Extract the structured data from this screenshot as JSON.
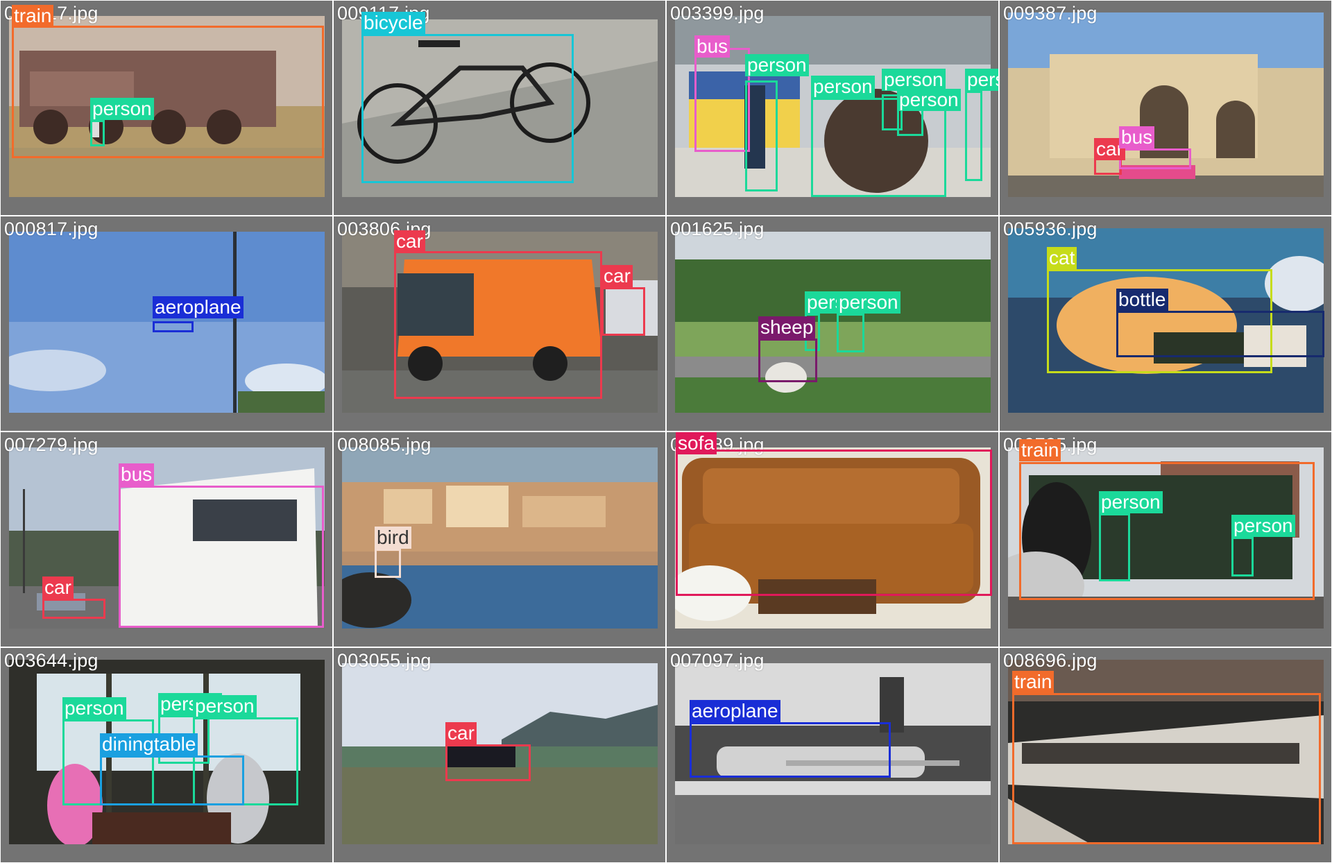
{
  "colors": {
    "train": "#f26b2b",
    "person": "#1bd99a",
    "bicycle": "#17c6d6",
    "bus": "#e85dcb",
    "car": "#ec3a4e",
    "aeroplane": "#1a2ed6",
    "sheep": "#7a1a6b",
    "cat": "#c6dc1a",
    "bottle": "#172a6e",
    "bird": "#f4ddd2",
    "sofa": "#e0195a",
    "diningtable": "#1aa0e0"
  },
  "tiles": [
    {
      "filename": "000017.jpg",
      "scene": "train-rusty",
      "labels": [
        "train",
        "person"
      ]
    },
    {
      "filename": "009117.jpg",
      "scene": "bicycle-street",
      "labels": [
        "bicycle"
      ]
    },
    {
      "filename": "003399.jpg",
      "scene": "bus-station",
      "labels": [
        "bus",
        "person",
        "person",
        "person",
        "person",
        "person"
      ]
    },
    {
      "filename": "009387.jpg",
      "scene": "union-station",
      "labels": [
        "car",
        "bus"
      ]
    },
    {
      "filename": "000817.jpg",
      "scene": "sky-plane",
      "labels": [
        "aeroplane"
      ]
    },
    {
      "filename": "003806.jpg",
      "scene": "orange-van",
      "labels": [
        "car",
        "car"
      ]
    },
    {
      "filename": "001625.jpg",
      "scene": "sheep-park",
      "labels": [
        "person",
        "person",
        "sheep"
      ]
    },
    {
      "filename": "005936.jpg",
      "scene": "cat-bottle",
      "labels": [
        "cat",
        "bottle"
      ]
    },
    {
      "filename": "007279.jpg",
      "scene": "fung-wah-bus",
      "labels": [
        "bus",
        "car"
      ]
    },
    {
      "filename": "008085.jpg",
      "scene": "coast-bird",
      "labels": [
        "bird"
      ]
    },
    {
      "filename": "004489.jpg",
      "scene": "leather-sofa",
      "labels": [
        "sofa"
      ]
    },
    {
      "filename": "009735.jpg",
      "scene": "steam-train",
      "labels": [
        "train",
        "person",
        "person"
      ]
    },
    {
      "filename": "003644.jpg",
      "scene": "restaurant",
      "labels": [
        "person",
        "person",
        "person",
        "diningtable"
      ]
    },
    {
      "filename": "003055.jpg",
      "scene": "car-field",
      "labels": [
        "car"
      ]
    },
    {
      "filename": "007097.jpg",
      "scene": "airfield",
      "labels": [
        "aeroplane"
      ]
    },
    {
      "filename": "008696.jpg",
      "scene": "modern-train",
      "labels": [
        "train"
      ]
    }
  ]
}
